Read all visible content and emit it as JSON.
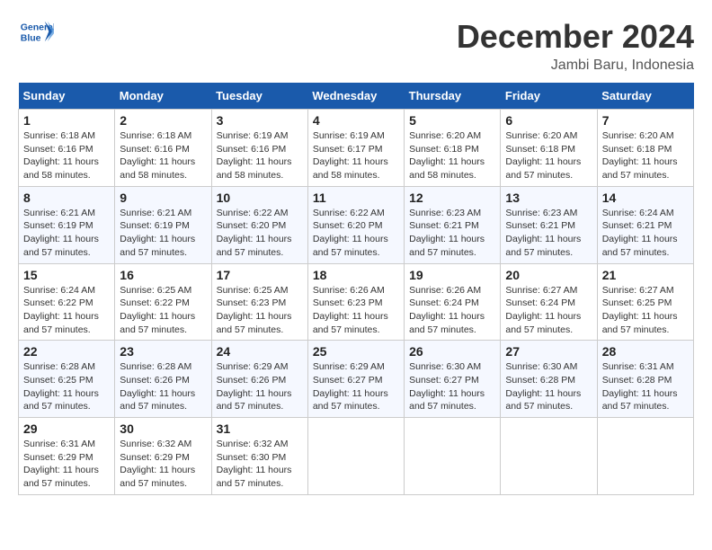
{
  "logo": {
    "line1": "General",
    "line2": "Blue"
  },
  "title": "December 2024",
  "subtitle": "Jambi Baru, Indonesia",
  "days_header": [
    "Sunday",
    "Monday",
    "Tuesday",
    "Wednesday",
    "Thursday",
    "Friday",
    "Saturday"
  ],
  "weeks": [
    [
      {
        "day": "1",
        "sunrise": "6:18 AM",
        "sunset": "6:16 PM",
        "daylight": "11 hours and 58 minutes."
      },
      {
        "day": "2",
        "sunrise": "6:18 AM",
        "sunset": "6:16 PM",
        "daylight": "11 hours and 58 minutes."
      },
      {
        "day": "3",
        "sunrise": "6:19 AM",
        "sunset": "6:16 PM",
        "daylight": "11 hours and 58 minutes."
      },
      {
        "day": "4",
        "sunrise": "6:19 AM",
        "sunset": "6:17 PM",
        "daylight": "11 hours and 58 minutes."
      },
      {
        "day": "5",
        "sunrise": "6:20 AM",
        "sunset": "6:18 PM",
        "daylight": "11 hours and 58 minutes."
      },
      {
        "day": "6",
        "sunrise": "6:20 AM",
        "sunset": "6:18 PM",
        "daylight": "11 hours and 57 minutes."
      },
      {
        "day": "7",
        "sunrise": "6:20 AM",
        "sunset": "6:18 PM",
        "daylight": "11 hours and 57 minutes."
      }
    ],
    [
      {
        "day": "8",
        "sunrise": "6:21 AM",
        "sunset": "6:19 PM",
        "daylight": "11 hours and 57 minutes."
      },
      {
        "day": "9",
        "sunrise": "6:21 AM",
        "sunset": "6:19 PM",
        "daylight": "11 hours and 57 minutes."
      },
      {
        "day": "10",
        "sunrise": "6:22 AM",
        "sunset": "6:20 PM",
        "daylight": "11 hours and 57 minutes."
      },
      {
        "day": "11",
        "sunrise": "6:22 AM",
        "sunset": "6:20 PM",
        "daylight": "11 hours and 57 minutes."
      },
      {
        "day": "12",
        "sunrise": "6:23 AM",
        "sunset": "6:21 PM",
        "daylight": "11 hours and 57 minutes."
      },
      {
        "day": "13",
        "sunrise": "6:23 AM",
        "sunset": "6:21 PM",
        "daylight": "11 hours and 57 minutes."
      },
      {
        "day": "14",
        "sunrise": "6:24 AM",
        "sunset": "6:21 PM",
        "daylight": "11 hours and 57 minutes."
      }
    ],
    [
      {
        "day": "15",
        "sunrise": "6:24 AM",
        "sunset": "6:22 PM",
        "daylight": "11 hours and 57 minutes."
      },
      {
        "day": "16",
        "sunrise": "6:25 AM",
        "sunset": "6:22 PM",
        "daylight": "11 hours and 57 minutes."
      },
      {
        "day": "17",
        "sunrise": "6:25 AM",
        "sunset": "6:23 PM",
        "daylight": "11 hours and 57 minutes."
      },
      {
        "day": "18",
        "sunrise": "6:26 AM",
        "sunset": "6:23 PM",
        "daylight": "11 hours and 57 minutes."
      },
      {
        "day": "19",
        "sunrise": "6:26 AM",
        "sunset": "6:24 PM",
        "daylight": "11 hours and 57 minutes."
      },
      {
        "day": "20",
        "sunrise": "6:27 AM",
        "sunset": "6:24 PM",
        "daylight": "11 hours and 57 minutes."
      },
      {
        "day": "21",
        "sunrise": "6:27 AM",
        "sunset": "6:25 PM",
        "daylight": "11 hours and 57 minutes."
      }
    ],
    [
      {
        "day": "22",
        "sunrise": "6:28 AM",
        "sunset": "6:25 PM",
        "daylight": "11 hours and 57 minutes."
      },
      {
        "day": "23",
        "sunrise": "6:28 AM",
        "sunset": "6:26 PM",
        "daylight": "11 hours and 57 minutes."
      },
      {
        "day": "24",
        "sunrise": "6:29 AM",
        "sunset": "6:26 PM",
        "daylight": "11 hours and 57 minutes."
      },
      {
        "day": "25",
        "sunrise": "6:29 AM",
        "sunset": "6:27 PM",
        "daylight": "11 hours and 57 minutes."
      },
      {
        "day": "26",
        "sunrise": "6:30 AM",
        "sunset": "6:27 PM",
        "daylight": "11 hours and 57 minutes."
      },
      {
        "day": "27",
        "sunrise": "6:30 AM",
        "sunset": "6:28 PM",
        "daylight": "11 hours and 57 minutes."
      },
      {
        "day": "28",
        "sunrise": "6:31 AM",
        "sunset": "6:28 PM",
        "daylight": "11 hours and 57 minutes."
      }
    ],
    [
      {
        "day": "29",
        "sunrise": "6:31 AM",
        "sunset": "6:29 PM",
        "daylight": "11 hours and 57 minutes."
      },
      {
        "day": "30",
        "sunrise": "6:32 AM",
        "sunset": "6:29 PM",
        "daylight": "11 hours and 57 minutes."
      },
      {
        "day": "31",
        "sunrise": "6:32 AM",
        "sunset": "6:30 PM",
        "daylight": "11 hours and 57 minutes."
      },
      null,
      null,
      null,
      null
    ]
  ],
  "labels": {
    "sunrise": "Sunrise:",
    "sunset": "Sunset:",
    "daylight": "Daylight:"
  }
}
